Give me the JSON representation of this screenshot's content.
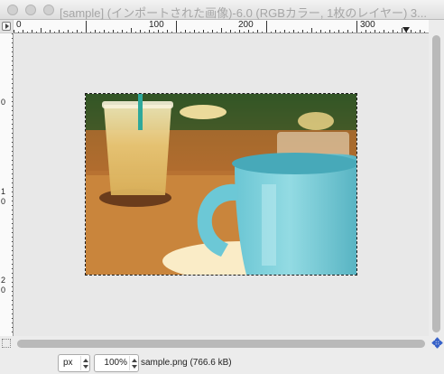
{
  "window": {
    "title": "[sample] (インポートされた画像)-6.0 (RGBカラー, 1枚のレイヤー) 3..."
  },
  "rulers": {
    "horizontal_labels": [
      "0",
      "100",
      "200",
      "300"
    ],
    "vertical_labels": [
      [
        "0"
      ],
      [
        "1",
        "0"
      ],
      [
        "2",
        "0"
      ]
    ]
  },
  "icons": {
    "window_close": "close-icon",
    "window_minimize": "minimize-icon",
    "window_zoom": "zoom-icon",
    "menu": "menu-arrow-icon",
    "quick_mask": "quick-mask-icon",
    "navigate": "navigate-icon"
  },
  "statusbar": {
    "unit": "px",
    "zoom": "100%",
    "file_info": "sample.png (766.6 kB)"
  }
}
